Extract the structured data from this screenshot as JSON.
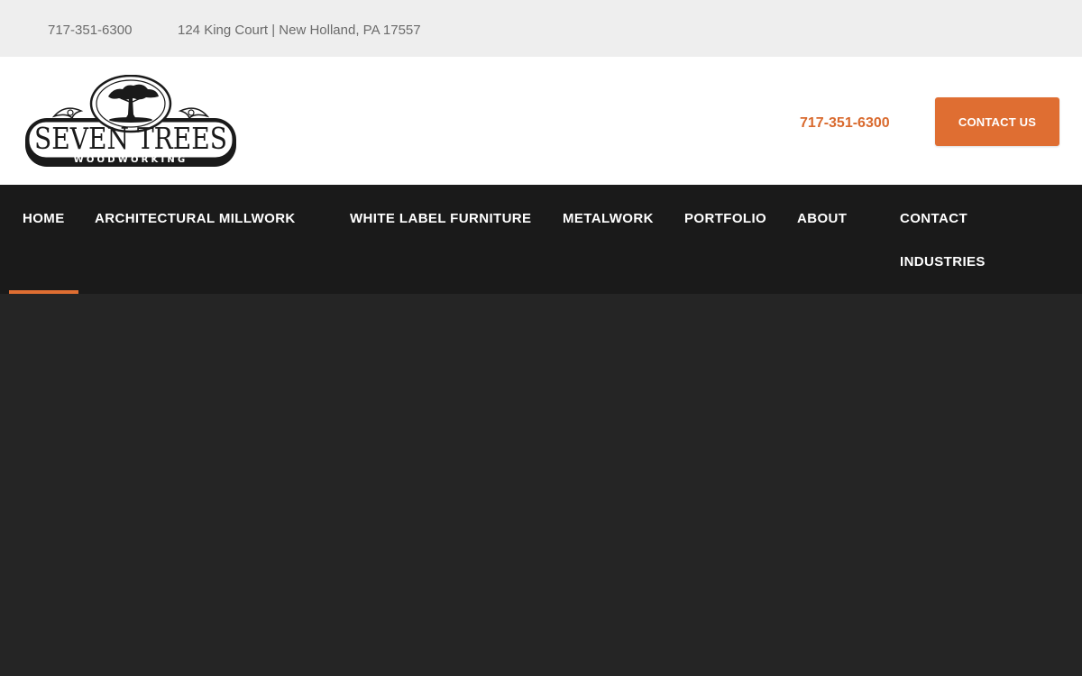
{
  "topbar": {
    "phone": "717-351-6300",
    "address": "124 King Court | New Holland, PA 17557"
  },
  "header": {
    "logo": {
      "icon": "tree-logo-icon",
      "name": "SEVEN TREES",
      "tagline": "WOODWORKING"
    },
    "phone": "717-351-6300",
    "contact_button": "CONTACT US"
  },
  "nav": {
    "active": "HOME",
    "items": [
      "HOME",
      "ARCHITECTURAL MILLWORK",
      "WHITE LABEL FURNITURE",
      "METALWORK",
      "PORTFOLIO",
      "ABOUT",
      "CONTACT",
      "INDUSTRIES"
    ]
  },
  "colors": {
    "accent": "#df6e32",
    "nav_bg": "#1a1a1a",
    "hero_bg": "#252525",
    "topbar_bg": "#eeeeee"
  }
}
